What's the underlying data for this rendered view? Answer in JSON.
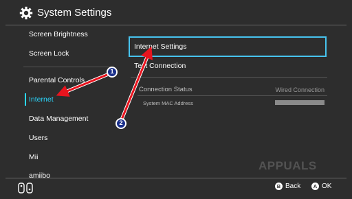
{
  "header": {
    "title": "System Settings",
    "icon": "gear-icon"
  },
  "sidebar": {
    "items": [
      {
        "label": "Screen Brightness"
      },
      {
        "label": "Screen Lock"
      },
      {
        "label": "Parental Controls"
      },
      {
        "label": "Internet",
        "selected": true
      },
      {
        "label": "Data Management"
      },
      {
        "label": "Users"
      },
      {
        "label": "Mii"
      },
      {
        "label": "amiibo"
      }
    ]
  },
  "panel": {
    "internet_settings": "Internet Settings",
    "test_connection": "Test Connection",
    "connection_status_label": "Connection Status",
    "connection_status_value": "Wired Connection",
    "mac_label": "System MAC Address"
  },
  "annotations": {
    "badge1": "1",
    "badge2": "2"
  },
  "footer": {
    "back_key": "B",
    "back_label": "Back",
    "ok_key": "A",
    "ok_label": "OK"
  },
  "watermark": "APPUALS",
  "colors": {
    "accent": "#2ad8ff",
    "focus_border": "#47c4ef",
    "arrow": "#e8141e",
    "badge": "#1a2f8a"
  }
}
